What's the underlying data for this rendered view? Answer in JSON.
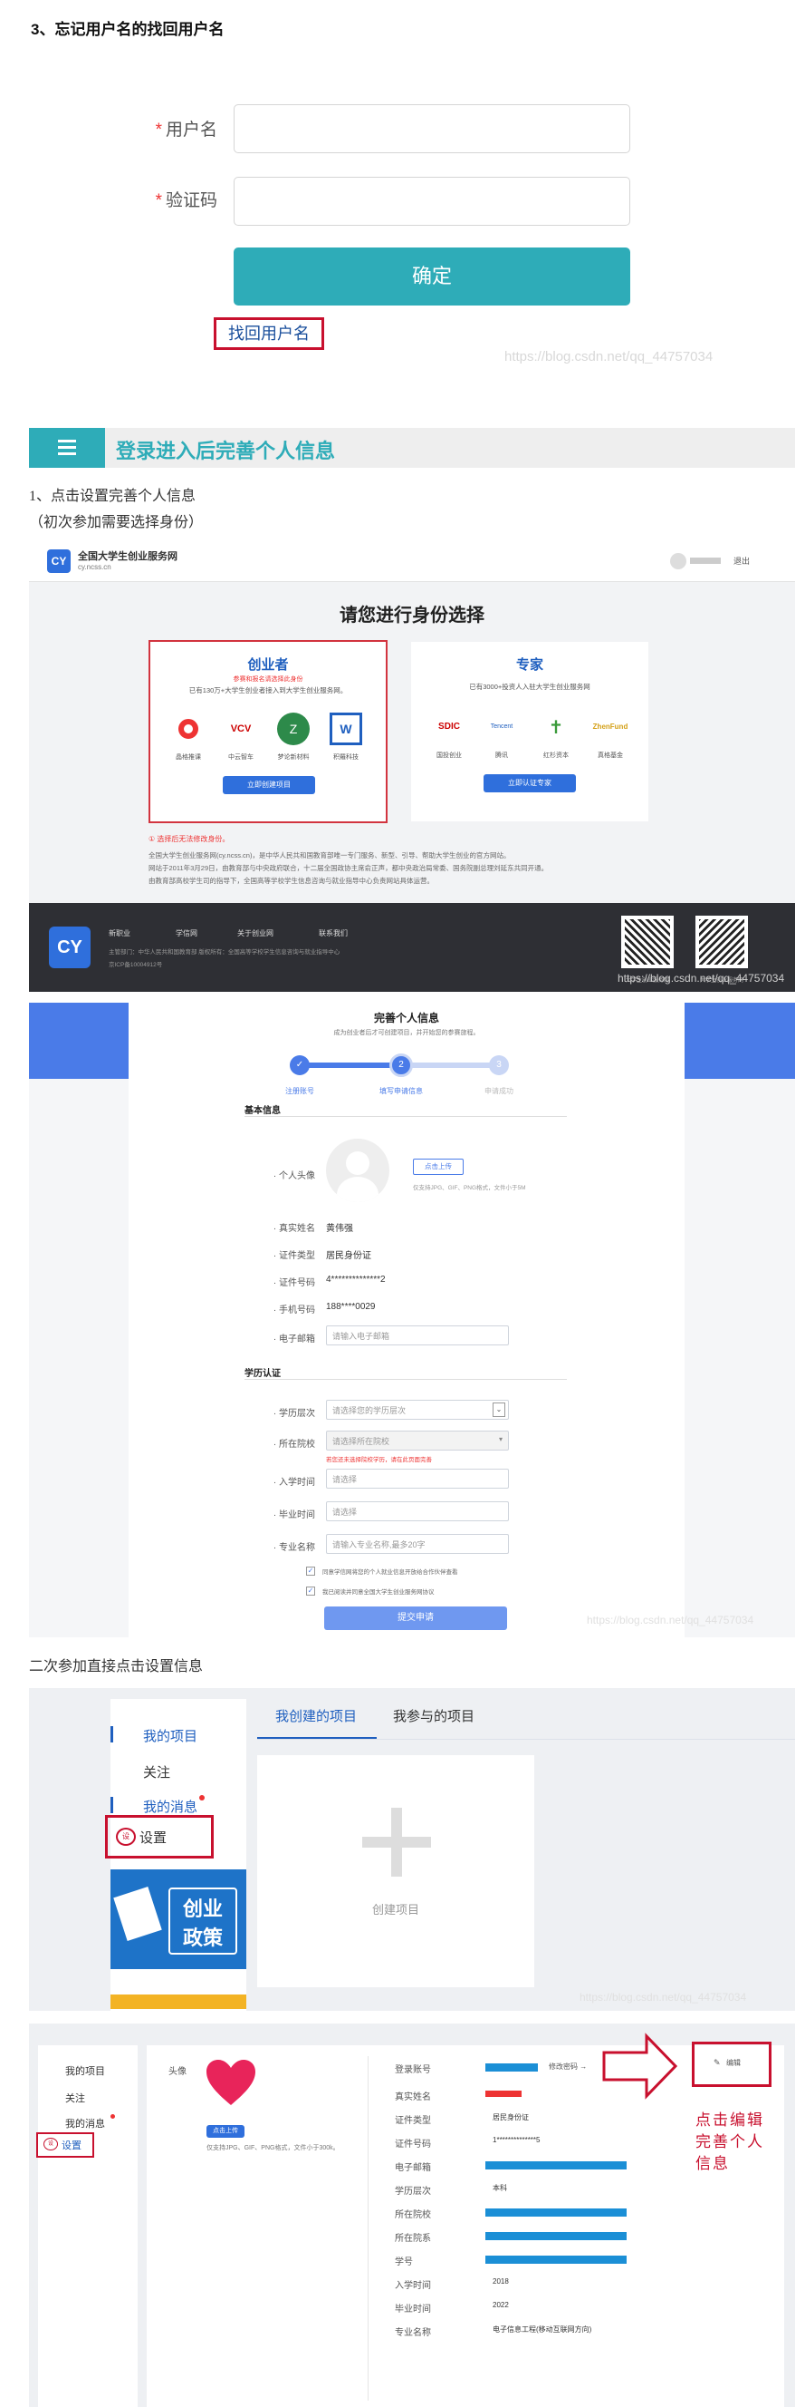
{
  "section3": {
    "heading": "3、忘记用户名的找回用户名",
    "username_label": "用户名",
    "captcha_label": "验证码",
    "required_mark": "*",
    "confirm_button": "确定",
    "recover_link": "找回用户名",
    "watermark": "https://blog.csdn.net/qq_44757034"
  },
  "banner": {
    "menu_icon": "hamburger-icon",
    "title": "登录进入后完善个人信息"
  },
  "step1": {
    "line1": "1、点击设置完善个人信息",
    "line2": "（初次参加需要选择身份）"
  },
  "identity_page": {
    "site_name": "全国大学生创业服务网",
    "site_url": "cy.ncss.cn",
    "logout": "退出",
    "choose_title": "请您进行身份选择",
    "entrepreneur": {
      "title": "创业者",
      "subtitle": "参赛和报名请选择此身份",
      "desc": "已有130万+大学生创业者接入到大学生创业服务网。",
      "logos": [
        "晶格推课",
        "中云智车",
        "梦论新材料",
        "积羅科技"
      ],
      "button": "立即创建项目"
    },
    "expert": {
      "title": "专家",
      "desc": "已有3000+投资人入驻大学生创业服务网",
      "logos": [
        "国投创业",
        "腾讯",
        "红杉资本",
        "真格基金"
      ],
      "button": "立即认证专家"
    },
    "warning": "① 选择后无法修改身份。",
    "intro1": "全国大学生创业服务网(cy.ncss.cn)，是中华人民共和国教育部唯一专门服务、新型、引导、帮助大学生创业的官方网站。",
    "intro2": "网站于2011年3月29日，由教育部与中央政府联合，十二届全国政协主席俞正声，都中央政治局常委、国务院副总理刘延东共同开通。",
    "intro3": "由教育部高校学生司的指导下，全国高等学校学生信息咨询与就业指导中心负责网站具体运营。",
    "footer_links": [
      "新职业",
      "学信网",
      "关于创业网",
      "联系我们"
    ],
    "footer_line1": "主管部门：中华人民共和国教育部    版权所有：全国高等学校学生信息咨询与就业指导中心",
    "footer_line2": "京ICP备10004912号",
    "qr_caption1": "大学生创业服务网",
    "qr_caption2": "大学生创业服务网"
  },
  "profile_form": {
    "title": "完善个人信息",
    "subtitle": "成为创业者后才可创建项目，并开始您的参赛旅程。",
    "steps": [
      "注册账号",
      "填写申请信息",
      "申请成功"
    ],
    "step_numbers": [
      "✓",
      "2",
      "3"
    ],
    "basic_section": "基本信息",
    "avatar_label": "· 个人头像",
    "upload_button": "点击上传",
    "upload_hint": "仅支持JPG、GIF、PNG格式，文件小于5M",
    "name_label": "· 真实姓名",
    "name_value": "黄伟强",
    "idtype_label": "· 证件类型",
    "idtype_value": "居民身份证",
    "idno_label": "· 证件号码",
    "idno_value": "4**************2",
    "phone_label": "· 手机号码",
    "phone_value": "188****0029",
    "email_label": "· 电子邮箱",
    "email_placeholder": "请输入电子邮箱",
    "edu_section": "学历认证",
    "degree_label": "· 学历层次",
    "degree_placeholder": "请选择您的学历层次",
    "school_label": "· 所在院校",
    "school_placeholder": "请选择所在院校",
    "school_hint": "若您还未选择院校学历，请在此页面完善",
    "enroll_label": "· 入学时间",
    "enroll_placeholder": "请选择",
    "grad_label": "· 毕业时间",
    "grad_placeholder": "请选择",
    "major_label": "· 专业名称",
    "major_placeholder": "请输入专业名称,最多20字",
    "agree1": "同意学信网将您的个人就业信息开放给合作伙伴查看",
    "agree2": "我已阅读并同意全国大学生创业服务网协议",
    "submit": "提交申请"
  },
  "step2": {
    "text": "二次参加直接点击设置信息"
  },
  "settings_page": {
    "menu": [
      "我的项目",
      "关注",
      "我的消息",
      "设置"
    ],
    "tabs": [
      "我创建的项目",
      "我参与的项目"
    ],
    "create_project": "创建项目",
    "promo_line1": "创业",
    "promo_line2": "政策"
  },
  "info_page": {
    "menu": [
      "我的项目",
      "关注",
      "我的消息",
      "设置"
    ],
    "avatar_label": "头像",
    "upload_button": "点击上传",
    "upload_hint": "仅支持JPG、GIF、PNG格式，文件小于300k。",
    "edit_button": "编辑",
    "change_password": "修改密码 →",
    "fields": [
      {
        "label": "登录账号",
        "value": ""
      },
      {
        "label": "真实姓名",
        "value": ""
      },
      {
        "label": "证件类型",
        "value": "居民身份证"
      },
      {
        "label": "证件号码",
        "value": "1**************5"
      },
      {
        "label": "电子邮箱",
        "value": ""
      },
      {
        "label": "学历层次",
        "value": "本科"
      },
      {
        "label": "所在院校",
        "value": ""
      },
      {
        "label": "所在院系",
        "value": ""
      },
      {
        "label": "学号",
        "value": ""
      },
      {
        "label": "入学时间",
        "value": "2018"
      },
      {
        "label": "毕业时间",
        "value": "2022"
      },
      {
        "label": "专业名称",
        "value": "电子信息工程(移动互联网方向)"
      }
    ],
    "annotation": [
      "点击编辑",
      "完善个人",
      "信息"
    ]
  }
}
